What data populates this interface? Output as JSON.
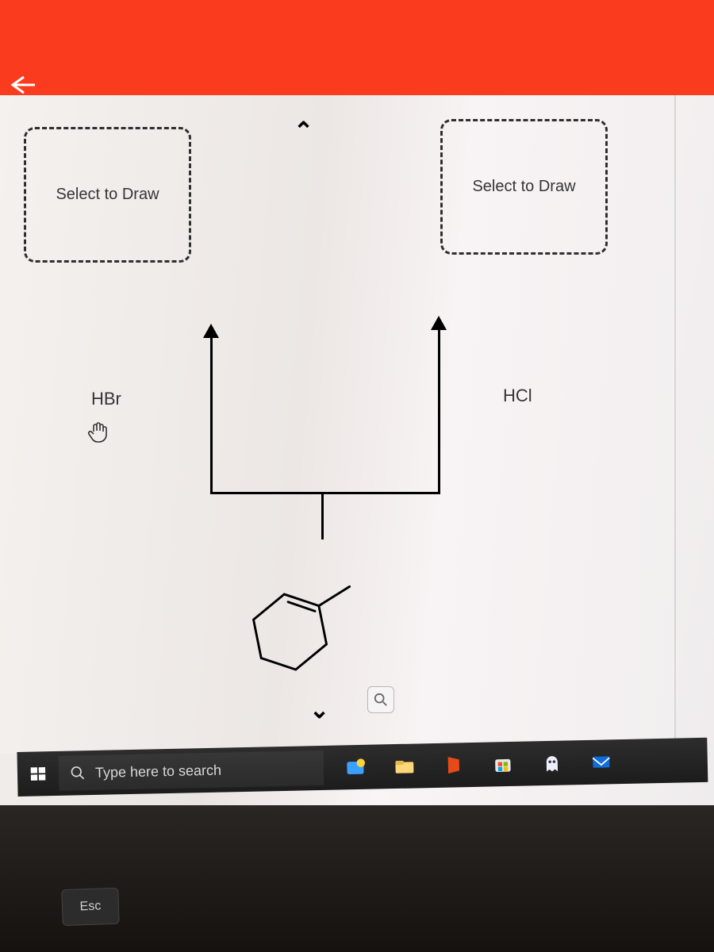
{
  "header": {
    "back": "←"
  },
  "drawbox": {
    "left_label": "Select to Draw",
    "right_label": "Select to Draw"
  },
  "reagents": {
    "left": "HBr",
    "right": "HCl"
  },
  "taskbar": {
    "search_placeholder": "Type here to search"
  },
  "keyboard": {
    "esc": "Esc"
  }
}
